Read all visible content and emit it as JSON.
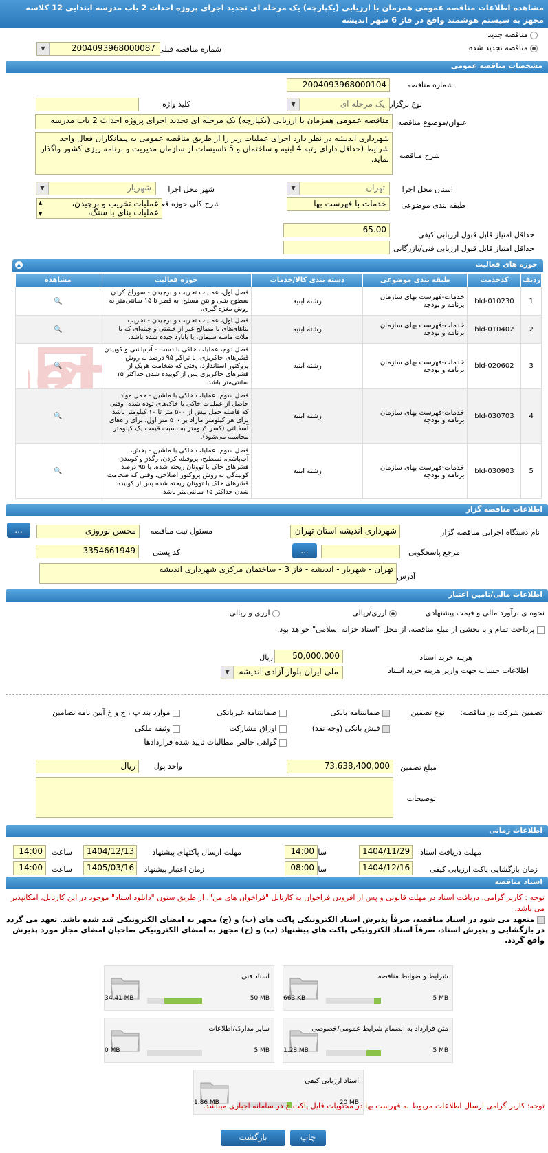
{
  "title": "مشاهده اطلاعات مناقصه عمومی همزمان با ارزیابی (یکپارچه) یک مرحله ای تجدید اجرای پروژه احداث 2 باب مدرسه ابتدایی 12 کلاسه مجهز به سیستم هوشمند واقع در فاز 6 شهر اندیشه",
  "tender_type": {
    "new_label": "مناقصه جدید",
    "renewed_label": "مناقصه تجدید شده",
    "prev_number_label": "شماره مناقصه قبلی",
    "prev_number": "2004093968000087"
  },
  "general": {
    "header": "مشخصات مناقصه عمومی",
    "number_label": "شماره مناقصه",
    "number": "2004093968000104",
    "holding_type_label": "نوع برگزاری",
    "holding_type": "یک مرحله ای",
    "keyword_label": "کلید واژه",
    "subject_label": "عنوان/موضوع مناقصه",
    "subject": "مناقصه عمومی همزمان با ارزیابی (یکپارچه) یک مرحله ای تجدید اجرای پروژه احداث 2 باب مدرسه",
    "description_label": "شرح مناقصه",
    "description": "شهرداری اندیشه در نظر دارد اجرای عملیات زیر را  از طریق مناقصه عمومی به پیمانکاران فعال واجد شرایط (حداقل دارای رتبه 4 ابنیه و ساختمان و 5 تاسیسات از سازمان مدیریت و برنامه ریزی کشور واگذار نماید.",
    "province_label": "استان محل اجرا",
    "province": "تهران",
    "city_label": "شهر محل اجرا",
    "city": "شهریار",
    "category_label": "طبقه بندی موضوعی",
    "category": "خدمات با فهرست بها",
    "scope_label": "شرح کلی حوزه فعالیت",
    "scope_lines": [
      "عملیات تخریب و برچیدن،",
      "عملیات بنای با سنگ،"
    ],
    "min_quality_label": "حداقل امتیاز قابل قبول ارزیابی کیفی",
    "min_quality": "65.00",
    "min_tech_label": "حداقل امتیاز قابل قبول ارزیابی فنی/بازرگانی"
  },
  "activities": {
    "header": "حوزه های فعالیت",
    "columns": [
      "ردیف",
      "کدخدمت",
      "طبقه بندی موضوعی",
      "دسته بندی کالا/خدمات",
      "حوزه فعالیت",
      "مشاهده"
    ],
    "rows": [
      {
        "idx": "1",
        "code": "bld-010230",
        "cat": "خدمات-فهرست بهای سازمان برنامه و بودجه",
        "group": "رشته ابنیه",
        "scope": "فصل اول، عملیات تخریب و برچیدن - سوراخ کردن سطوح بتنی و بتن مسلح، به قطر تا ۱۵ سانتی‌متر به روش مغزه گیری."
      },
      {
        "idx": "2",
        "code": "bld-010402",
        "cat": "خدمات-فهرست بهای سازمان برنامه و بودجه",
        "group": "رشته ابنیه",
        "scope": "فصل اول، عملیات تخریب و برچیدن - تخریب بناهای‌های با مصالح غیر از خشتی و چینه‌ای که با ملات ماسه سیمان، یا باتارد چیده شده باشد."
      },
      {
        "idx": "3",
        "code": "bld-020602",
        "cat": "خدمات-فهرست بهای سازمان برنامه و بودجه",
        "group": "رشته ابنیه",
        "scope": "فصل دوم، عملیات خاکی با دست - آب‌پاشی و کوبیدن قشرهای خاکریزی، با تراکم ۹۵ درصد به روش پروکتور استاندارد، وقتی که ضخامت هریک از قشرهای خاکریزی پس از کوبیده شدن حداکثر ۱۵ سانتی‌متر باشد."
      },
      {
        "idx": "4",
        "code": "bld-030703",
        "cat": "خدمات-فهرست بهای سازمان برنامه و بودجه",
        "group": "رشته ابنیه",
        "scope": "فصل سوم، عملیات خاکی با ماشین - حمل مواد حاصل از عملیات خاکی یا خاک‌های توده شده، وقتی که فاصله حمل بیش از ۵۰۰ متر تا ۱۰ کیلومتر باشد، برای هر کیلومتر مازاد بر ۵۰۰ متر اول، برای راه‌های آسفالتی (کسر کیلومتر به نسبت قیمت یک کیلومتر محاسبه می‌شود)."
      },
      {
        "idx": "5",
        "code": "bld-030903",
        "cat": "خدمات-فهرست بهای سازمان برنامه و بودجه",
        "group": "رشته ابنیه",
        "scope": "فصل سوم، عملیات خاکی با ماشین - پخش، آب‌پاشی، تسطیح، پروفیله کردن، رگلاژ و کوبیدن قشرهای خاک یا توونان ریخته شده، با ۹۵ درصد کوبیدگی به روش پروکتور اصلاحی، وقتی که ضخامت قشرهای خاک یا توونان ریخته شده پس از کوبیده شدن حداکثر ۱۵ سانتی‌متر باشد."
      }
    ]
  },
  "organizer": {
    "header": "اطلاعات مناقصه گزار",
    "agency_label": "نام دستگاه اجرایی مناقصه گزار",
    "agency": "شهرداری اندیشه استان تهران",
    "registrar_label": "مسئول ثبت مناقصه",
    "registrar": "محسن نوروزی",
    "ref_label": "مرجع پاسخگویی",
    "postal_label": "کد پستی",
    "postal": "3354661949",
    "address_label": "آدرس",
    "address": "تهران - شهریار - اندیشه - فاز 3 - ساختمان مرکزی شهرداری اندیشه",
    "more_button": "..."
  },
  "finance": {
    "header": "اطلاعات مالی/تامین اعتبار",
    "estimate_label": "نحوه ی برآورد مالی و قیمت پیشنهادی",
    "opt_rial": "ارزی/ریالی",
    "opt_currency_rial": "ارزی و ریالی",
    "treasury_text": "پرداخت تمام و یا بخشی از مبلغ مناقصه، از محل \"اسناد خزانه اسلامی\" خواهد بود.",
    "doc_fee_label": "هزینه خرید اسناد",
    "doc_fee": "50,000,000",
    "doc_fee_unit": "ریال",
    "account_label": "اطلاعات حساب جهت واریز هزینه خرید اسناد",
    "account": "ملی ایران بلوار آزادی اندیشه"
  },
  "guarantee": {
    "label": "تضمین شرکت در مناقصه:",
    "type_label": "نوع تضمین",
    "options": [
      {
        "label": "ضمانتنامه بانکی",
        "checked": true
      },
      {
        "label": "ضمانتنامه غیربانکی",
        "checked": false
      },
      {
        "label": "موارد بند پ ، ج و خ آیین نامه تضامین",
        "checked": false
      },
      {
        "label": "فیش بانکی (وجه نقد)",
        "checked": true
      },
      {
        "label": "اوراق مشارکت",
        "checked": false
      },
      {
        "label": "وثیقه ملکی",
        "checked": false
      },
      {
        "label": "گواهی خالص مطالبات تایید شده قراردادها",
        "checked": false
      }
    ],
    "amount_label": "مبلغ تضمین",
    "amount": "73,638,400,000",
    "unit_label": "واحد پول",
    "unit": "ریال",
    "notes_label": "توضیحات"
  },
  "timing": {
    "header": "اطلاعات زمانی",
    "doc_receive_label": "مهلت دریافت اسناد",
    "doc_receive_date": "1404/11/29",
    "time_label": "ساعت",
    "doc_receive_time": "14:00",
    "submit_label": "مهلت ارسال پاکتهای پیشنهاد",
    "submit_date": "1404/12/13",
    "submit_time": "14:00",
    "quality_open_label": "زمان بازگشایی پاکت ارزیابی کیفی",
    "quality_open_date": "1404/12/16",
    "quality_open_time": "08:00",
    "validity_label": "زمان اعتبار پیشنهاد",
    "validity_date": "1405/03/16",
    "validity_time": "14:00"
  },
  "documents": {
    "header": "اسناد مناقصه",
    "notice1": "توجه : کاربر گرامی، دریافت اسناد در مهلت قانونی و پس از افزودن فراخوان به کارتابل \"فراخوان های من\"، از طریق ستون \"دانلود اسناد\" موجود در این کارتابل، امکانپذیر می باشد.",
    "commitment": "متعهد می شود در اسناد مناقصه، صرفاً پذیرش اسناد الکترونیکی پاکت های (ب) و (ج) مجهز به امضای الکترونیکی قید شده باشد. تعهد می گردد در بازگشایی و پذیرش اسناد، صرفاً اسناد الکترونیکی پاکت های پیشنهاد (ب) و (ج) مجهز به امضای الکترونیکی صاحبان امضای مجاز مورد پذیرش واقع گردد.",
    "files": [
      {
        "name": "شرایط و ضوابط مناقصه",
        "used": "663 KB",
        "max": "5 MB",
        "pct": 13
      },
      {
        "name": "اسناد فنی",
        "used": "34.41 MB",
        "max": "50 MB",
        "pct": 69
      },
      {
        "name": "متن قرارداد به انضمام شرایط عمومی/خصوصی",
        "used": "1.28 MB",
        "max": "5 MB",
        "pct": 26
      },
      {
        "name": "سایر مدارک/اطلاعات",
        "used": "0 MB",
        "max": "5 MB",
        "pct": 0
      },
      {
        "name": "اسناد ارزیابی کیفی",
        "used": "1.86 MB",
        "max": "20 MB",
        "pct": 9
      }
    ],
    "notice2": "توجه: کاربر گرامی ارسال اطلاعات مربوط به فهرست بها در محتویات فایل پاکت ج در سامانه اجباری میباشد."
  },
  "buttons": {
    "print": "چاپ",
    "back": "بازگشت"
  },
  "watermark": "ParsTender.net",
  "colors": {
    "accent": "#2f7fc0",
    "field": "#ffffcc",
    "warning": "#cc0000"
  }
}
